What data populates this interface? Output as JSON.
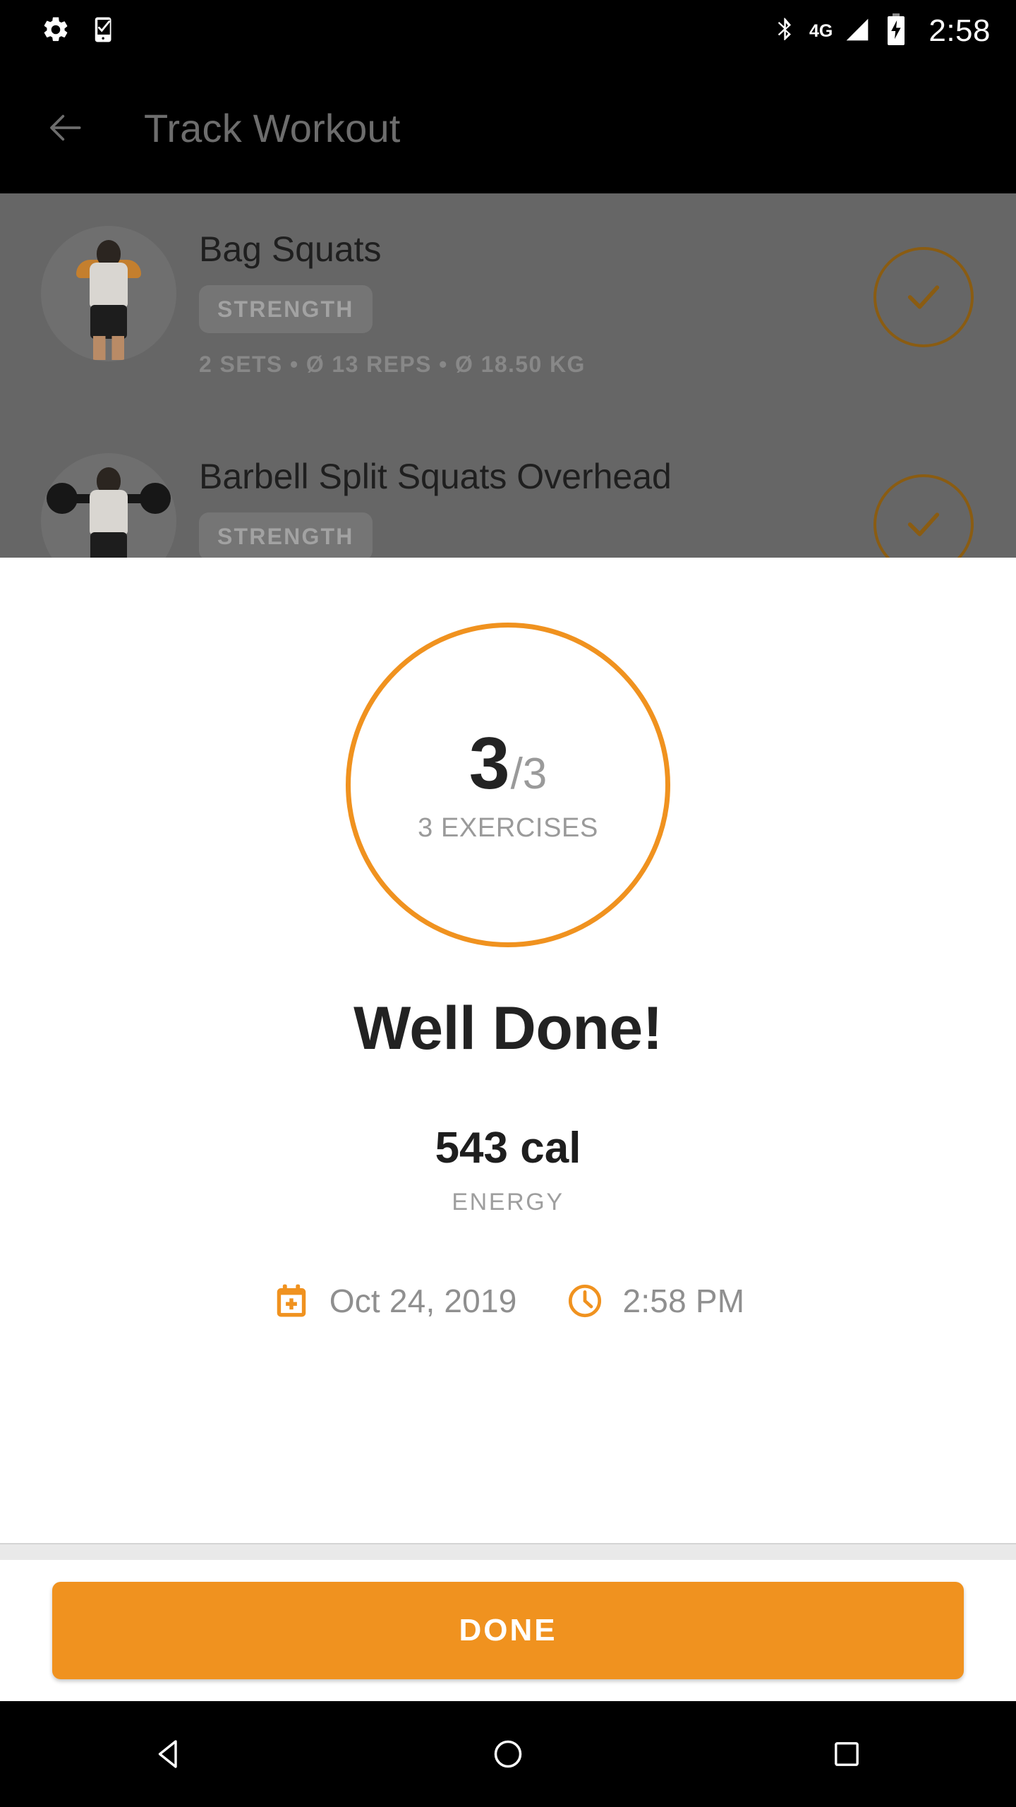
{
  "status_bar": {
    "time": "2:58",
    "network_label": "4G",
    "icons": [
      "settings-gear-icon",
      "phone-check-icon",
      "bluetooth-icon",
      "signal-4g-icon",
      "battery-charging-icon"
    ]
  },
  "app_bar": {
    "title": "Track Workout",
    "back_label": "Back"
  },
  "background_list": {
    "exercises": [
      {
        "name": "Bag Squats",
        "category": "STRENGTH",
        "meta": "2 SETS  •  Ø 13 REPS  •  Ø 18.50 KG",
        "completed": true
      },
      {
        "name": "Barbell Split Squats Overhead",
        "category": "STRENGTH",
        "meta": "",
        "completed": true
      }
    ]
  },
  "summary_sheet": {
    "progress": {
      "current": "3",
      "total": "/3",
      "label": "3 EXERCISES"
    },
    "headline": "Well Done!",
    "energy": {
      "value": "543 cal",
      "label": "ENERGY"
    },
    "date": "Oct 24, 2019",
    "time": "2:58 PM",
    "done_label": "DONE"
  },
  "nav_bar": {
    "back": "back-triangle-icon",
    "home": "home-circle-icon",
    "recents": "recents-square-icon"
  },
  "colors": {
    "accent_orange": "#F0921F",
    "scrim_gray": "#666666",
    "text_dark": "#222222",
    "text_muted": "#9a9a9a"
  }
}
